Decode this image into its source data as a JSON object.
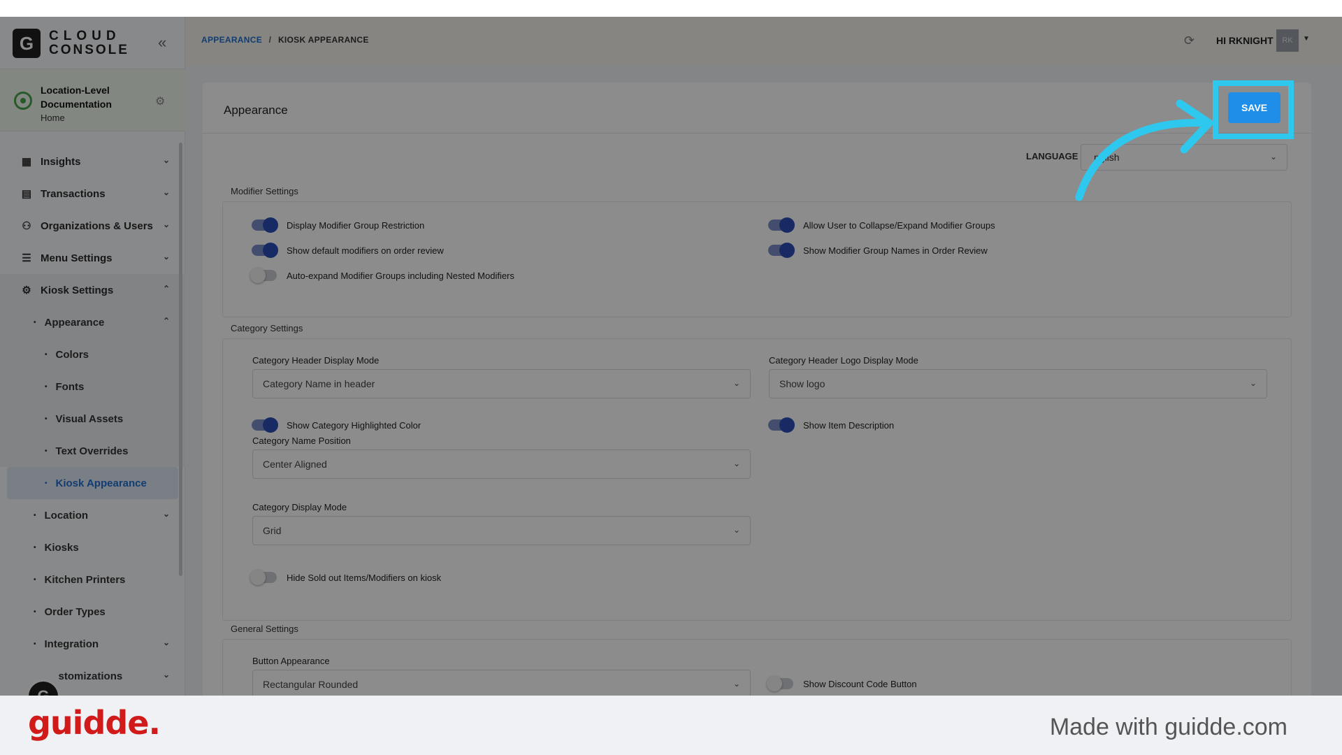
{
  "brand": {
    "logo_letter": "G",
    "line1": "CLOUD",
    "line2": "CONSOLE",
    "collapse_icon": "«"
  },
  "location": {
    "name": "Location-Level Documentation",
    "sub": "Home"
  },
  "nav": {
    "insights": "Insights",
    "transactions": "Transactions",
    "organizations": "Organizations & Users",
    "menu_settings": "Menu Settings",
    "kiosk_settings": "Kiosk Settings",
    "appearance": "Appearance",
    "colors": "Colors",
    "fonts": "Fonts",
    "visual_assets": "Visual Assets",
    "text_overrides": "Text Overrides",
    "kiosk_appearance": "Kiosk Appearance",
    "location": "Location",
    "kiosks": "Kiosks",
    "kitchen_printers": "Kitchen Printers",
    "order_types": "Order Types",
    "integration": "Integration",
    "customizations": "stomizations"
  },
  "header": {
    "breadcrumb_link": "APPEARANCE",
    "breadcrumb_sep": "/",
    "breadcrumb_current": "KIOSK APPEARANCE",
    "greeting": "HI RKNIGHT",
    "avatar_initials": "RK"
  },
  "card": {
    "title": "Appearance",
    "save_label": "SAVE",
    "language_label": "LANGUAGE",
    "language_value": "nglish"
  },
  "modifier": {
    "section_label": "Modifier Settings",
    "display_restriction": "Display Modifier Group Restriction",
    "allow_collapse": "Allow User to Collapse/Expand Modifier Groups",
    "show_default": "Show default modifiers on order review",
    "show_group_names": "Show Modifier Group Names in Order Review",
    "auto_expand": "Auto-expand Modifier Groups including Nested Modifiers"
  },
  "category": {
    "section_label": "Category Settings",
    "header_mode_label": "Category Header Display Mode",
    "header_mode_value": "Category Name in header",
    "logo_mode_label": "Category Header Logo Display Mode",
    "logo_mode_value": "Show logo",
    "highlight_color": "Show Category Highlighted Color",
    "item_description": "Show Item Description",
    "name_position_label": "Category Name Position",
    "name_position_value": "Center Aligned",
    "display_mode_label": "Category Display Mode",
    "display_mode_value": "Grid",
    "hide_sold_out": "Hide Sold out Items/Modifiers on kiosk"
  },
  "general": {
    "section_label": "General Settings",
    "button_appearance_label": "Button Appearance",
    "button_appearance_value": "Rectangular Rounded",
    "discount_code": "Show Discount Code Button"
  },
  "footer": {
    "logo": "guidde.",
    "text": "Made with guidde.com"
  },
  "colors": {
    "accent": "#1f8ee8",
    "highlight": "#2ec8ef",
    "toggle_on": "#2b4db7",
    "footer_logo": "#d11b1b"
  }
}
